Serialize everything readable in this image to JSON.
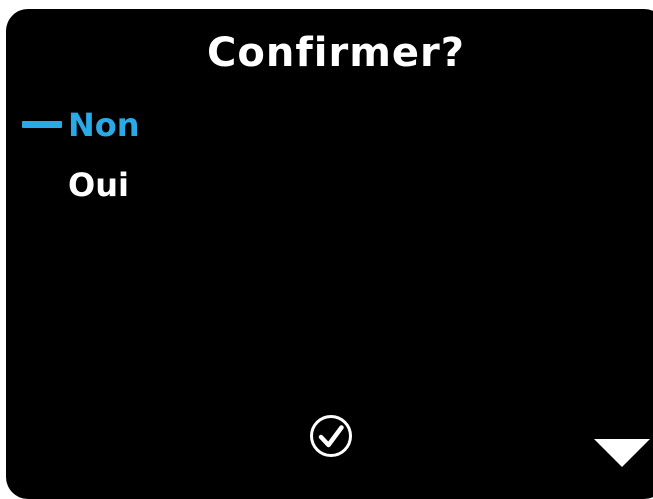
{
  "dialog": {
    "title": "Confirmer?"
  },
  "menu": {
    "items": [
      {
        "label": "Non",
        "selected": true
      },
      {
        "label": "Oui",
        "selected": false
      }
    ]
  },
  "softkeys": {
    "confirm_icon": "check-circle-icon",
    "next_icon": "triangle-down-icon"
  },
  "colors": {
    "background": "#000000",
    "text": "#ffffff",
    "accent": "#29a9e6"
  }
}
